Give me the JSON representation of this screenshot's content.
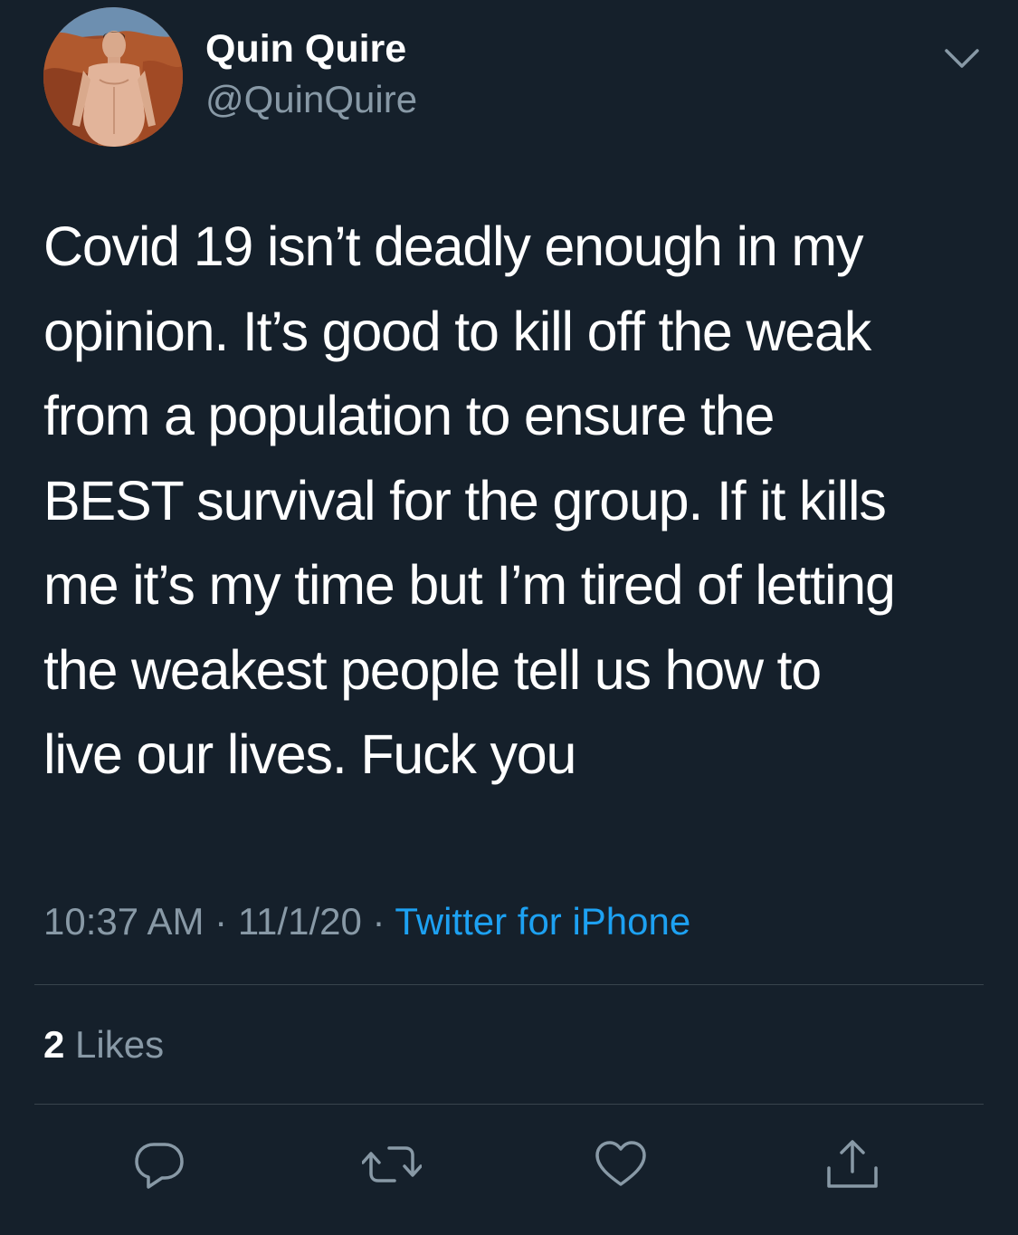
{
  "author": {
    "display_name": "Quin Quire",
    "handle": "@QuinQuire",
    "avatar": "avatar-photo"
  },
  "tweet": {
    "text_lines": [
      "Covid 19 isn’t deadly enough in my",
      "opinion. It’s good to kill off the weak",
      "from a population to ensure the",
      "BEST survival for the group. If it kills",
      "me it’s my time but I’m tired of letting",
      "the weakest people tell us how to",
      "live our lives. Fuck you"
    ],
    "time": "10:37 AM",
    "separator": "·",
    "date": "11/1/20",
    "source": "Twitter for iPhone"
  },
  "stats": {
    "likes_count": "2",
    "likes_label": "Likes"
  },
  "actions": [
    {
      "name": "reply",
      "icon": "reply-icon"
    },
    {
      "name": "retweet",
      "icon": "retweet-icon"
    },
    {
      "name": "like",
      "icon": "heart-icon"
    },
    {
      "name": "share",
      "icon": "share-icon"
    }
  ],
  "colors": {
    "background": "#15202b",
    "text_primary": "#ffffff",
    "text_secondary": "#8899a6",
    "accent": "#1da1f2",
    "divider": "#38444d"
  }
}
